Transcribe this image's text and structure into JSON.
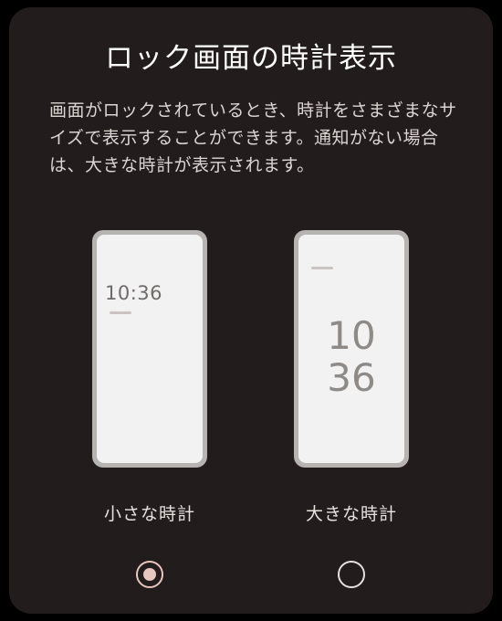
{
  "dialog": {
    "title": "ロック画面の時計表示",
    "description": "画面がロックされているとき、時計をさまざまなサイズで表示することができます。通知がない場合は、大きな時計が表示されます。"
  },
  "options": [
    {
      "label": "小さな時計",
      "preview_time": "10:36",
      "selected": true
    },
    {
      "label": "大きな時計",
      "preview_hour": "10",
      "preview_minute": "36",
      "selected": false
    }
  ],
  "colors": {
    "dialog_background": "#231c1c",
    "radio_accent": "#e6c6bd"
  }
}
